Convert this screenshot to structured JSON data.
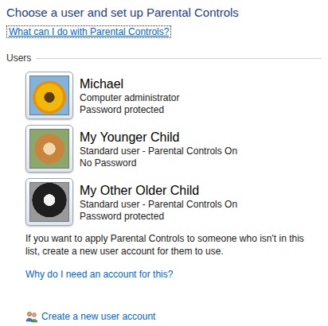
{
  "window": {
    "title": "Choose a user and set up Parental Controls"
  },
  "help_link": {
    "label": "What can I do with Parental Controls?",
    "focused": true
  },
  "group": {
    "label": "Users"
  },
  "users": [
    {
      "name": "Michael",
      "role": "Computer administrator",
      "password": "Password protected"
    },
    {
      "name": "My Younger Child",
      "role": "Standard user - Parental Controls On",
      "password": "No Password"
    },
    {
      "name": "My Other Older Child",
      "role": "Standard user - Parental Controls On",
      "password": "Password protected"
    }
  ],
  "note": "If you want to apply Parental Controls to someone who isn't in this list, create a new user account for them to use.",
  "why_link": "Why do I need an account for this?",
  "create_link": "Create a new user account"
}
